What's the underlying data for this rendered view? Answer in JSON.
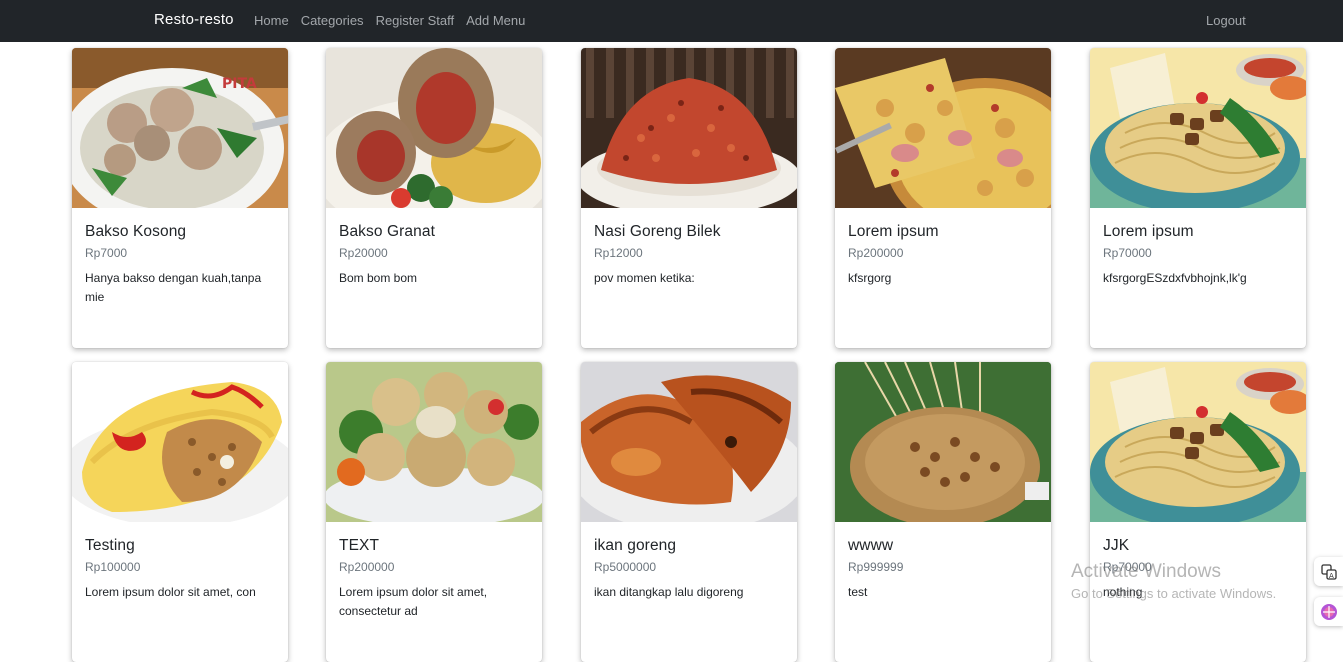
{
  "navbar": {
    "brand": "Resto-resto",
    "links": [
      "Home",
      "Categories",
      "Register Staff",
      "Add Menu"
    ],
    "logout": "Logout"
  },
  "menu_items": [
    {
      "name": "Bakso Kosong",
      "price": "Rp7000",
      "description": "Hanya bakso dengan kuah,tanpa mie",
      "image": "meatball-soup"
    },
    {
      "name": "Bakso Granat",
      "price": "Rp20000",
      "description": "Bom bom bom",
      "image": "stuffed-meatball-noodles"
    },
    {
      "name": "Nasi Goreng Bilek",
      "price": "Rp12000",
      "description": "pov momen ketika:",
      "image": "fried-rice"
    },
    {
      "name": "Lorem ipsum",
      "price": "Rp200000",
      "description": "kfsrgorg",
      "image": "pizza"
    },
    {
      "name": "Lorem ipsum",
      "price": "Rp70000",
      "description": "kfsrgorgESzdxfvbhojnk,lk'g",
      "image": "chicken-noodles"
    },
    {
      "name": "Testing",
      "price": "Rp100000",
      "description": "Lorem ipsum dolor sit amet, con",
      "image": "omelette-rice"
    },
    {
      "name": "TEXT",
      "price": "Rp200000",
      "description": "Lorem ipsum dolor sit amet, consectetur ad",
      "image": "fried-dumplings"
    },
    {
      "name": "ikan goreng",
      "price": "Rp5000000",
      "description": "ikan ditangkap lalu digoreng",
      "image": "fried-fish"
    },
    {
      "name": "wwww",
      "price": "Rp999999",
      "description": "test",
      "image": "satay-peanut-sauce"
    },
    {
      "name": "JJK",
      "price": "Rp70000",
      "description": "nothing",
      "image": "chicken-noodles"
    }
  ],
  "overlay": {
    "watermark_title": "Activate Windows",
    "watermark_subtitle": "Go to Settings to activate Windows."
  },
  "colors": {
    "navbar_bg": "#212529",
    "brand": "#ffffff",
    "nav_link": "#a3a7ab",
    "price": "#6c757d"
  }
}
